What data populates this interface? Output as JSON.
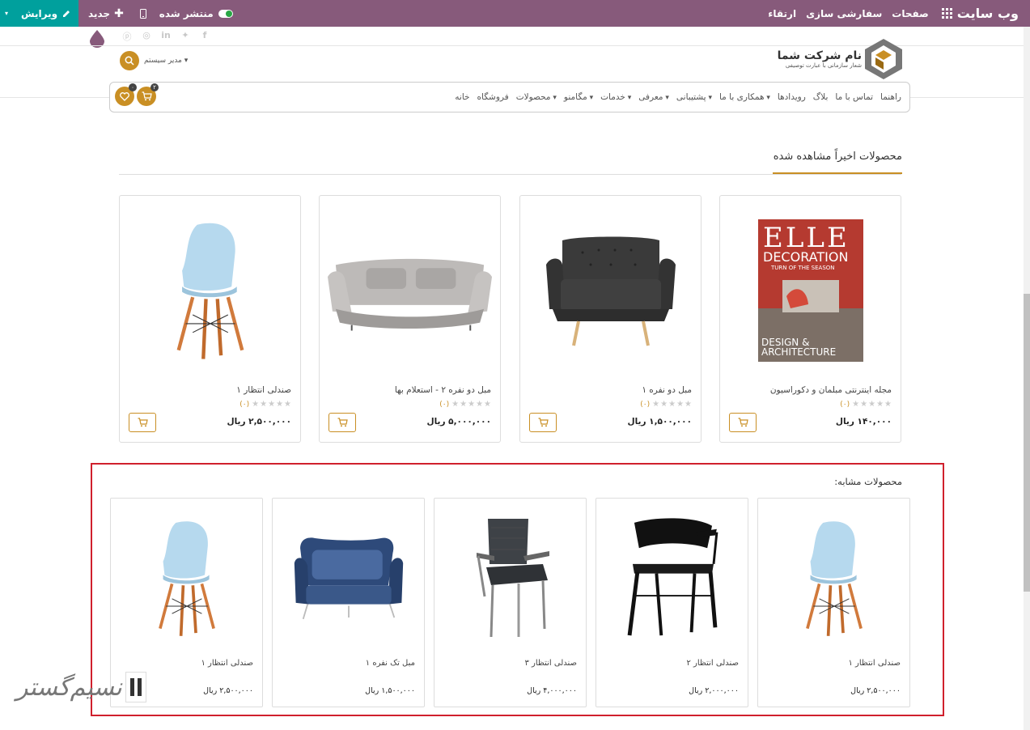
{
  "topbar": {
    "brand": "وب سایت",
    "links": [
      "صفحات",
      "سفارشی سازی",
      "ارتقاء"
    ],
    "publish_label": "منتشر شده",
    "new_label": "جدید",
    "edit_label": "ویرایش"
  },
  "header": {
    "company_name": "نام شرکت شما",
    "company_tagline": "شعار سازمانی با عبارت توصیفی",
    "user_name": "مدیر سیستم",
    "cart_count": "۲",
    "wishlist_count": "۰"
  },
  "nav": {
    "items": [
      {
        "label": "خانه",
        "dropdown": false
      },
      {
        "label": "فروشگاه",
        "dropdown": false
      },
      {
        "label": "محصولات",
        "dropdown": true
      },
      {
        "label": "مگامنو",
        "dropdown": true
      },
      {
        "label": "خدمات",
        "dropdown": true
      },
      {
        "label": "معرفی",
        "dropdown": true
      },
      {
        "label": "پشتیبانی",
        "dropdown": true
      },
      {
        "label": "همکاری با ما",
        "dropdown": true
      },
      {
        "label": "رویدادها",
        "dropdown": false
      },
      {
        "label": "بلاگ",
        "dropdown": false
      },
      {
        "label": "تماس با ما",
        "dropdown": false
      },
      {
        "label": "راهنما",
        "dropdown": false
      }
    ]
  },
  "recent": {
    "title": "محصولات اخیراً مشاهده شده",
    "products": [
      {
        "name": "مجله اینترنتی مبلمان و دکوراسیون",
        "price": "۱۴۰,۰۰۰ ریال",
        "rating_count": "(۰)",
        "image": "magazine"
      },
      {
        "name": "مبل دو نفره ۱",
        "price": "۱,۵۰۰,۰۰۰ ریال",
        "rating_count": "(۰)",
        "image": "dark-sofa"
      },
      {
        "name": "مبل دو نفره ۲ - استعلام بها",
        "price": "۵,۰۰۰,۰۰۰ ریال",
        "rating_count": "(۰)",
        "image": "grey-sofa"
      },
      {
        "name": "صندلی انتظار ۱",
        "price": "۲,۵۰۰,۰۰۰ ریال",
        "rating_count": "(۰)",
        "image": "blue-chair"
      }
    ],
    "magazine": {
      "title": "ELLE",
      "subtitle": "DECORATION",
      "tagline": "TURN OF THE SEASON",
      "footer1": "DESIGN &",
      "footer2": "ARCHITECTURE"
    }
  },
  "similar": {
    "title": "محصولات مشابه:",
    "products": [
      {
        "name": "صندلی انتظار ۱",
        "price": "۲,۵۰۰,۰۰۰ ریال",
        "image": "blue-chair"
      },
      {
        "name": "صندلی انتظار ۲",
        "price": "۲,۰۰۰,۰۰۰ ریال",
        "image": "black-chair"
      },
      {
        "name": "صندلی انتظار ۳",
        "price": "۴,۰۰۰,۰۰۰ ریال",
        "image": "office-chair"
      },
      {
        "name": "مبل تک نفره ۱",
        "price": "۱,۵۰۰,۰۰۰ ریال",
        "image": "blue-loveseat"
      },
      {
        "name": "صندلی انتظار ۱",
        "price": "۲,۵۰۰,۰۰۰ ریال",
        "image": "blue-chair"
      }
    ]
  },
  "watermark": {
    "text": "نسیم گستر"
  },
  "colors": {
    "topbar": "#875a7b",
    "edit": "#00a09d",
    "accent": "#c98f24",
    "highlight": "#d0202d"
  }
}
